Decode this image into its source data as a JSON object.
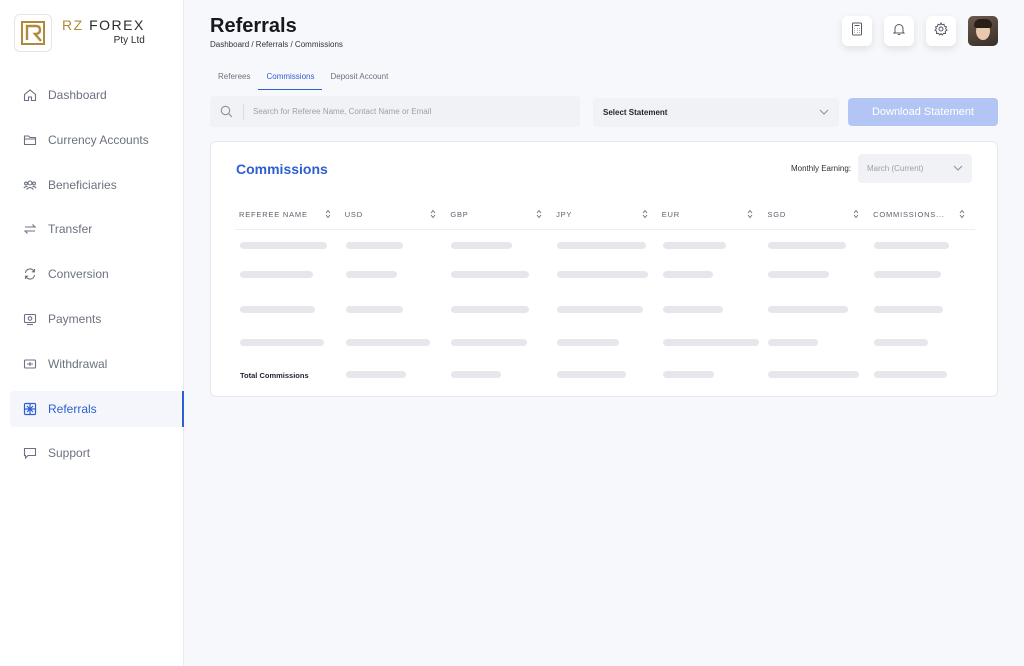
{
  "brand": {
    "name_part1": "RZ",
    "name_part2": "FOREX",
    "sub": "Pty Ltd"
  },
  "sidebar": {
    "items": [
      {
        "label": "Dashboard",
        "icon": "home-icon"
      },
      {
        "label": "Currency Accounts",
        "icon": "folder-icon"
      },
      {
        "label": "Beneficiaries",
        "icon": "users-icon"
      },
      {
        "label": "Transfer",
        "icon": "transfer-arrows-icon"
      },
      {
        "label": "Conversion",
        "icon": "refresh-icon"
      },
      {
        "label": "Payments",
        "icon": "payment-icon"
      },
      {
        "label": "Withdrawal",
        "icon": "withdrawal-icon"
      },
      {
        "label": "Referrals",
        "icon": "gift-icon",
        "active": true
      },
      {
        "label": "Support",
        "icon": "chat-icon"
      }
    ]
  },
  "header": {
    "title": "Referrals",
    "breadcrumb": "Dashboard / Referrals / Commissions",
    "icons": [
      "calculator-icon",
      "bell-icon",
      "gear-icon",
      "avatar"
    ]
  },
  "tabs": [
    {
      "label": "Referees",
      "active": false
    },
    {
      "label": "Commissions",
      "active": true
    },
    {
      "label": "Deposit Account",
      "active": false
    }
  ],
  "search": {
    "placeholder": "Search for Referee Name, Contact Name or Email",
    "value": ""
  },
  "statement_select": {
    "value": "Select Statement"
  },
  "download_button": {
    "label": "Download Statement"
  },
  "card": {
    "title": "Commissions",
    "monthly_label": "Monthly Earning:",
    "monthly_value": "March (Current)",
    "columns": [
      "REFEREE NAME",
      "USD",
      "GBP",
      "JPY",
      "EUR",
      "SGD",
      "COMMISSIONS..."
    ],
    "total_label": "Total Commissions"
  },
  "colors": {
    "accent": "#2d5fd3",
    "button_disabled": "#b3c5f5",
    "brand_gold": "#b08a3a"
  }
}
